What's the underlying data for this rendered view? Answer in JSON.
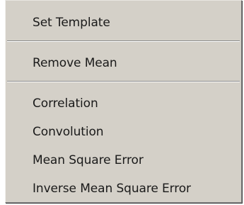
{
  "menu": {
    "items": [
      {
        "label": "Set Template"
      },
      {
        "label": "Remove Mean"
      },
      {
        "label": "Correlation"
      },
      {
        "label": "Convolution"
      },
      {
        "label": "Mean Square Error"
      },
      {
        "label": "Inverse Mean Square Error"
      }
    ]
  }
}
